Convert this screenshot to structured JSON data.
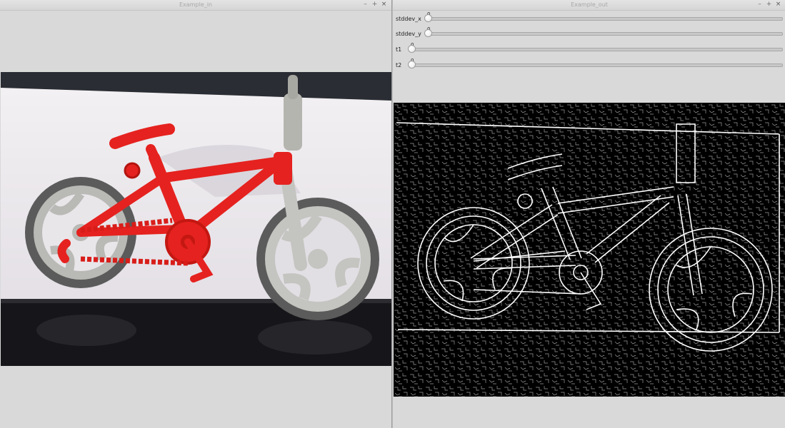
{
  "window_in": {
    "title": "Example_in",
    "controls": {
      "minimize": "–",
      "maximize": "+",
      "close": "×"
    }
  },
  "window_out": {
    "title": "Example_out",
    "controls": {
      "minimize": "–",
      "maximize": "+",
      "close": "×"
    },
    "trackbars": [
      {
        "label": "stddev_x",
        "value": "0"
      },
      {
        "label": "stddev_y",
        "value": "0"
      },
      {
        "label": "t1",
        "value": "0"
      },
      {
        "label": "t2",
        "value": "0"
      }
    ]
  },
  "colors": {
    "bike_red": "#e5221f",
    "tire": "#5b5b5b",
    "rim": "#b9b9b5",
    "edge_line": "#ffffff",
    "edge_bg": "#000000"
  },
  "icons": [
    "minimize-icon",
    "maximize-icon",
    "close-icon",
    "trackbar-handle"
  ]
}
